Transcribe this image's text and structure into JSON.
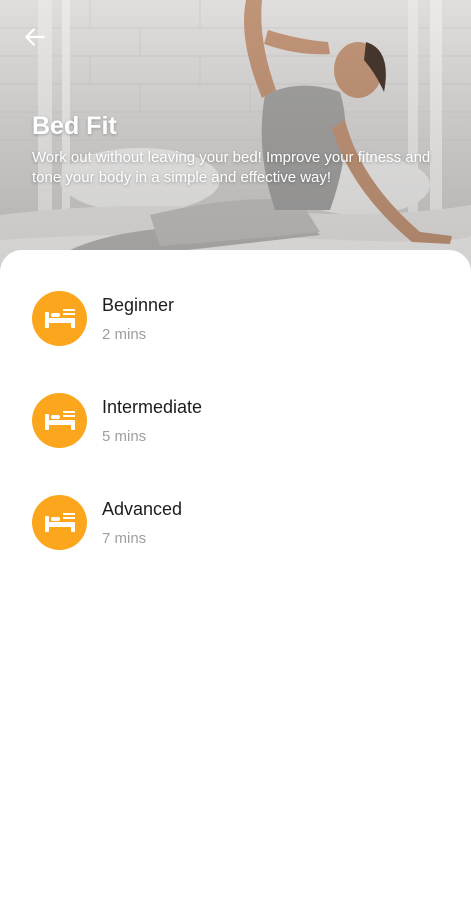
{
  "header": {
    "back_icon": "arrow-left-icon",
    "title": "Bed Fit",
    "description": "Work out without leaving your bed! Improve your fitness and tone your body in a simple and effective way!"
  },
  "levels": [
    {
      "name": "Beginner",
      "duration": "2 mins",
      "icon": "bed-icon"
    },
    {
      "name": "Intermediate",
      "duration": "5 mins",
      "icon": "bed-icon"
    },
    {
      "name": "Advanced",
      "duration": "7 mins",
      "icon": "bed-icon"
    }
  ],
  "colors": {
    "accent": "#fba61d",
    "title_text": "#1d1d1d",
    "secondary_text": "#9e9e9e",
    "hero_text": "#ffffff"
  }
}
